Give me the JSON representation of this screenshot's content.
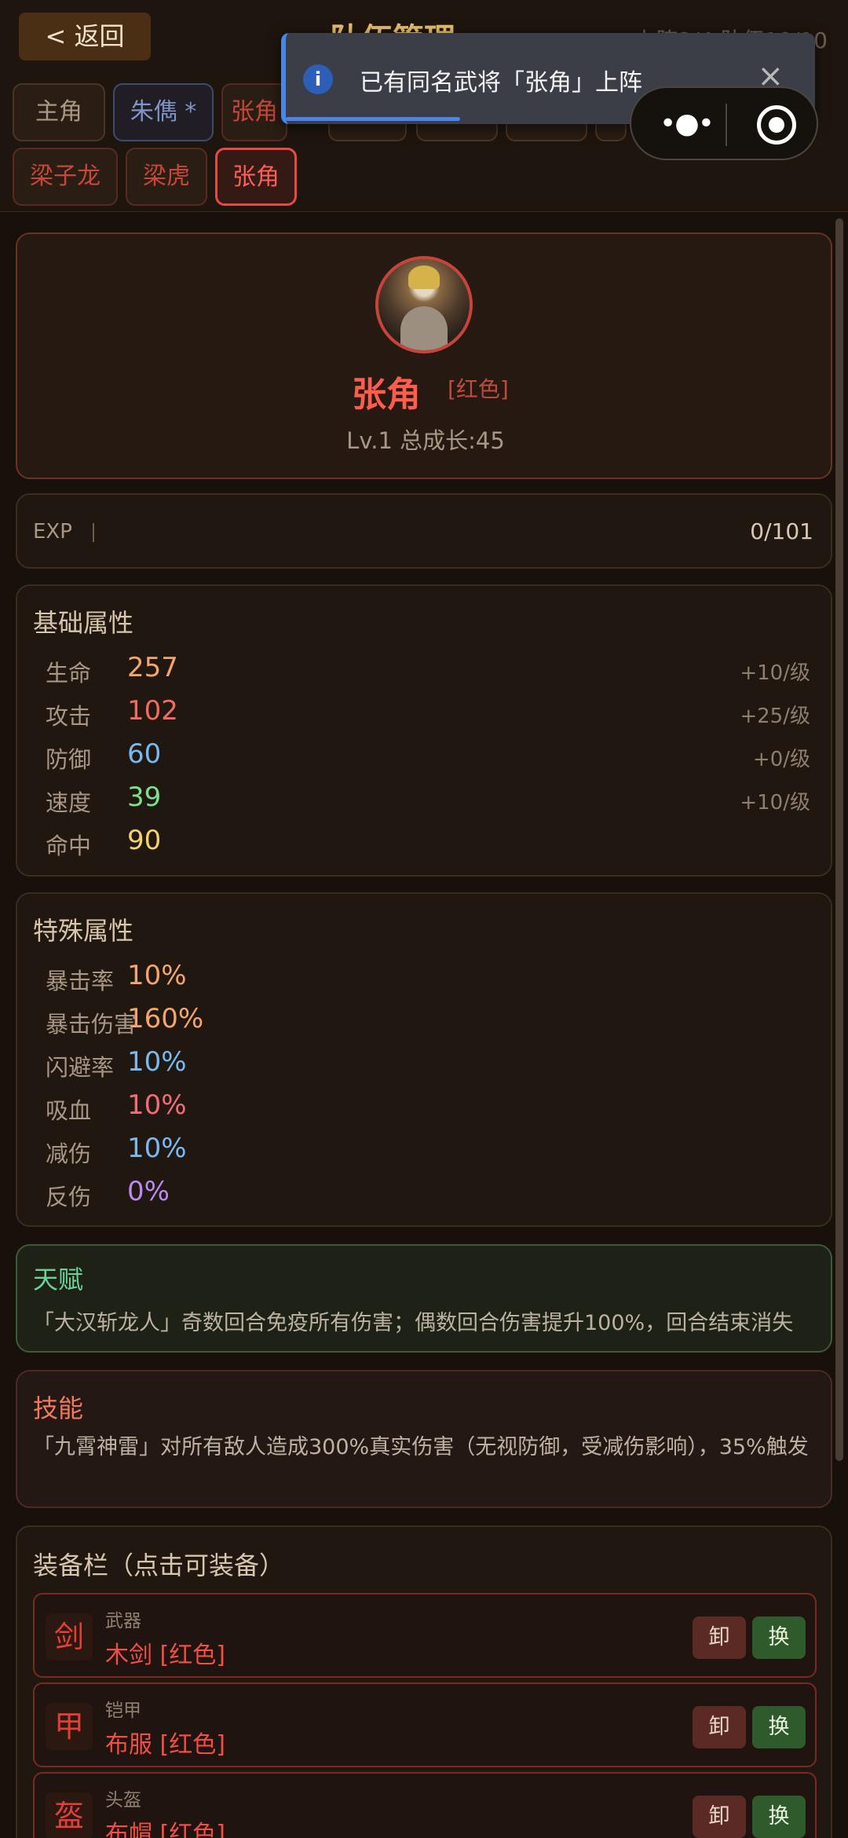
{
  "header": {
    "back_label": "< 返回",
    "title": "队伍管理",
    "counts": "上阵2/4 队伍10/10"
  },
  "tabs": [
    {
      "label": "主角"
    },
    {
      "label": "朱儁 *"
    },
    {
      "label": "张角"
    },
    {
      "label": ""
    },
    {
      "label": ""
    },
    {
      "label": ""
    },
    {
      "label": ""
    },
    {
      "label": ""
    },
    {
      "label": "梁子龙"
    },
    {
      "label": "梁虎"
    },
    {
      "label": "张角"
    }
  ],
  "toast": {
    "text": "已有同名武将「张角」上阵",
    "icon": "info-icon",
    "close": "×"
  },
  "capsule": {
    "more_icon": "more-dots-icon",
    "close_icon": "target-icon"
  },
  "hero": {
    "name": "张角",
    "rarity": "[红色]",
    "level_growth": "Lv.1  总成长:45"
  },
  "exp": {
    "label": "EXP",
    "value": "0/101",
    "progress": 0
  },
  "base_stats": {
    "title": "基础属性",
    "items": [
      {
        "label": "生命",
        "value": "257",
        "growth": "+10/级",
        "color": "#f3a56b"
      },
      {
        "label": "攻击",
        "value": "102",
        "growth": "+25/级",
        "color": "#f26b5e"
      },
      {
        "label": "防御",
        "value": "60",
        "growth": "+0/级",
        "color": "#7ab8f0"
      },
      {
        "label": "速度",
        "value": "39",
        "growth": "+10/级",
        "color": "#7be28c"
      },
      {
        "label": "命中",
        "value": "90",
        "growth": "",
        "color": "#f2d26b"
      }
    ]
  },
  "special_stats": {
    "title": "特殊属性",
    "items": [
      {
        "label": "暴击率",
        "value": "10%",
        "color": "#f3a56b"
      },
      {
        "label": "暴击伤害",
        "value": "160%",
        "color": "#f3a56b"
      },
      {
        "label": "闪避率",
        "value": "10%",
        "color": "#7ab8f0"
      },
      {
        "label": "吸血",
        "value": "10%",
        "color": "#f26b7a"
      },
      {
        "label": "减伤",
        "value": "10%",
        "color": "#7ab8f0"
      },
      {
        "label": "反伤",
        "value": "0%",
        "color": "#b98af0"
      }
    ]
  },
  "talent": {
    "title": "天赋",
    "desc": "「大汉斩龙人」奇数回合免疫所有伤害；偶数回合伤害提升100%，回合结束消失"
  },
  "skill": {
    "title": "技能",
    "desc": "「九霄神雷」对所有敌人造成300%真实伤害（无视防御，受减伤影响），35%触发"
  },
  "equipment": {
    "title": "装备栏（点击可装备）",
    "items": [
      {
        "icon": "剑",
        "type": "武器",
        "name": "木剑 [红色]",
        "unequip": "卸",
        "swap": "换"
      },
      {
        "icon": "甲",
        "type": "铠甲",
        "name": "布服 [红色]",
        "unequip": "卸",
        "swap": "换"
      },
      {
        "icon": "盔",
        "type": "头盔",
        "name": "布帽 [红色]",
        "unequip": "卸",
        "swap": "换"
      }
    ]
  }
}
